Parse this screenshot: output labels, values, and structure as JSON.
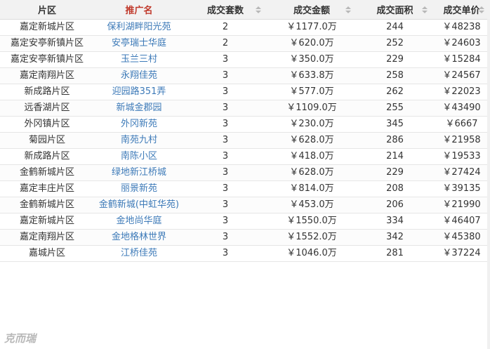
{
  "headers": {
    "district": "片区",
    "name": "推广名",
    "count": "成交套数",
    "amount": "成交金额",
    "area": "成交面积",
    "price": "成交单价"
  },
  "rows": [
    {
      "district": "嘉定新城片区",
      "name": "保利湖畔阳光苑",
      "count": "2",
      "amount": "￥1177.0万",
      "area": "244",
      "price": "￥48238"
    },
    {
      "district": "嘉定安亭新镇片区",
      "name": "安亭瑞士华庭",
      "count": "2",
      "amount": "￥620.0万",
      "area": "252",
      "price": "￥24603"
    },
    {
      "district": "嘉定安亭新镇片区",
      "name": "玉兰三村",
      "count": "3",
      "amount": "￥350.0万",
      "area": "229",
      "price": "￥15284"
    },
    {
      "district": "嘉定南翔片区",
      "name": "永翔佳苑",
      "count": "3",
      "amount": "￥633.8万",
      "area": "258",
      "price": "￥24567"
    },
    {
      "district": "新成路片区",
      "name": "迎园路351弄",
      "count": "3",
      "amount": "￥577.0万",
      "area": "262",
      "price": "￥22023"
    },
    {
      "district": "远香湖片区",
      "name": "新城金郡园",
      "count": "3",
      "amount": "￥1109.0万",
      "area": "255",
      "price": "￥43490"
    },
    {
      "district": "外冈镇片区",
      "name": "外冈新苑",
      "count": "3",
      "amount": "￥230.0万",
      "area": "345",
      "price": "￥6667"
    },
    {
      "district": "菊园片区",
      "name": "南苑九村",
      "count": "3",
      "amount": "￥628.0万",
      "area": "286",
      "price": "￥21958"
    },
    {
      "district": "新成路片区",
      "name": "南陈小区",
      "count": "3",
      "amount": "￥418.0万",
      "area": "214",
      "price": "￥19533"
    },
    {
      "district": "金鹤新城片区",
      "name": "绿地新江桥城",
      "count": "3",
      "amount": "￥628.0万",
      "area": "229",
      "price": "￥27424"
    },
    {
      "district": "嘉定丰庄片区",
      "name": "丽景新苑",
      "count": "3",
      "amount": "￥814.0万",
      "area": "208",
      "price": "￥39135"
    },
    {
      "district": "金鹤新城片区",
      "name": "金鹤新城(中虹华苑)",
      "count": "3",
      "amount": "￥453.0万",
      "area": "206",
      "price": "￥21990"
    },
    {
      "district": "嘉定新城片区",
      "name": "金地尚华庭",
      "count": "3",
      "amount": "￥1550.0万",
      "area": "334",
      "price": "￥46407"
    },
    {
      "district": "嘉定南翔片区",
      "name": "金地格林世界",
      "count": "3",
      "amount": "￥1552.0万",
      "area": "342",
      "price": "￥45380"
    },
    {
      "district": "嘉城片区",
      "name": "江桥佳苑",
      "count": "3",
      "amount": "￥1046.0万",
      "area": "281",
      "price": "￥37224"
    }
  ],
  "colors": {
    "brand_header": "#c0392b",
    "link": "#3d7ab8",
    "header_bg": "#f2f2f2"
  },
  "watermark": "克而瑞"
}
